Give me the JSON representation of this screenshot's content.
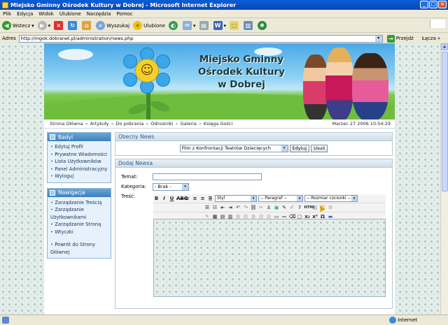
{
  "window": {
    "title": "Miejsko Gminny Ośrodek Kultury w Dobrej - Microsoft Internet Explorer"
  },
  "menu": [
    "Plik",
    "Edycja",
    "Widok",
    "Ulubione",
    "Narzędzia",
    "Pomoc"
  ],
  "toolbar": {
    "back": "Wstecz",
    "search": "Wyszukaj",
    "favorites": "Ulubione"
  },
  "address": {
    "label": "Adres",
    "url": "http://mgok.dobranet.pl/administration/news.php",
    "go": "Przejdź",
    "links": "Łącza"
  },
  "status": {
    "zone": "Internet"
  },
  "banner": {
    "line1": "Miejsko Gminny",
    "line2": "Ośrodek Kultury",
    "line3": "w Dobrej"
  },
  "nav": {
    "links": [
      "Strona Główna",
      "Artykuły",
      "Do pobrania",
      "Odnośniki",
      "Galeria",
      "Księga Gości"
    ],
    "datetime": "Marzec 27 2006 10:54:29"
  },
  "sidebar": {
    "box1": {
      "title": "Badyl",
      "items": [
        "Edytuj Profil",
        "Prywatne Wiadomości",
        "Lista Użytkowników",
        "Panel Administracyjny",
        "Wyloguj"
      ]
    },
    "box2": {
      "title": "Nawigacja",
      "items": [
        "Zarządzanie Treścią",
        "Zarządzanie",
        "Użytkownikami",
        "Zarządzanie Stroną",
        "Wtyczki"
      ],
      "back1": "Powrót do Strony",
      "back2": "Głównej"
    }
  },
  "current_news": {
    "title": "Obecny News",
    "selected": "Film z Konfrontacji Teatrów Dziecięcych",
    "edit": "Edytuj",
    "delete": "Usuń"
  },
  "add_news": {
    "title": "Dodaj Newsa",
    "subject_label": "Temat:",
    "category_label": "Kategoria:",
    "category_value": "- Brak -",
    "content_label": "Treść:",
    "style_value": "Styl",
    "paragraph_value": "-- Paragraf --",
    "fontsize_value": "-- Rozmiar czcionki --",
    "omega": "Ω"
  },
  "colors": {
    "accent": "#3e7fbf",
    "panel_title": "#2a5c8a",
    "xp_title": "#0a5fd8"
  }
}
